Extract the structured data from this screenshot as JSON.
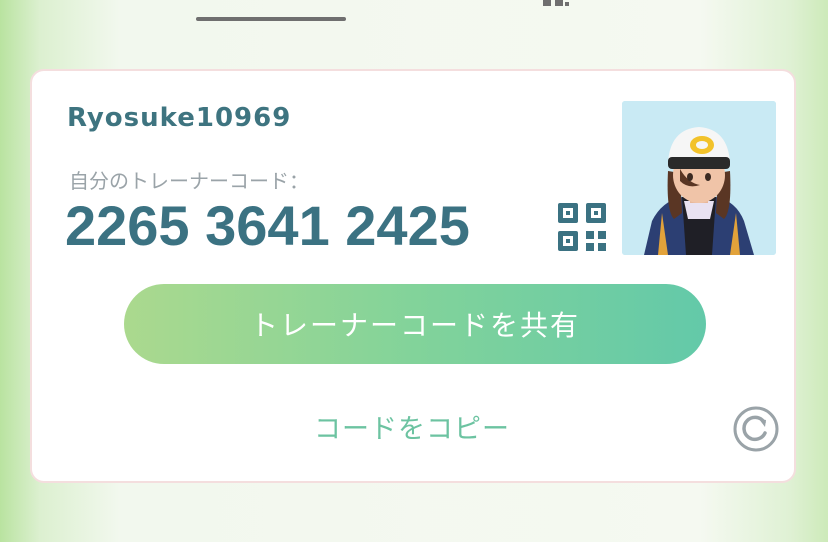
{
  "trainer": {
    "username": "Ryosuke10969",
    "code_caption": "自分のトレーナーコード：",
    "code": "2265 3641 2425"
  },
  "actions": {
    "share_label": "トレーナーコードを共有",
    "copy_label": "コードをコピー"
  },
  "icons": {
    "qr": "qr-code-icon",
    "refresh": "refresh-icon",
    "avatar": "trainer-avatar"
  },
  "colors": {
    "accent_text": "#3b7282",
    "share_gradient_start": "#abd98e",
    "share_gradient_end": "#63c9a9",
    "copy_text": "#6cc3a1"
  }
}
